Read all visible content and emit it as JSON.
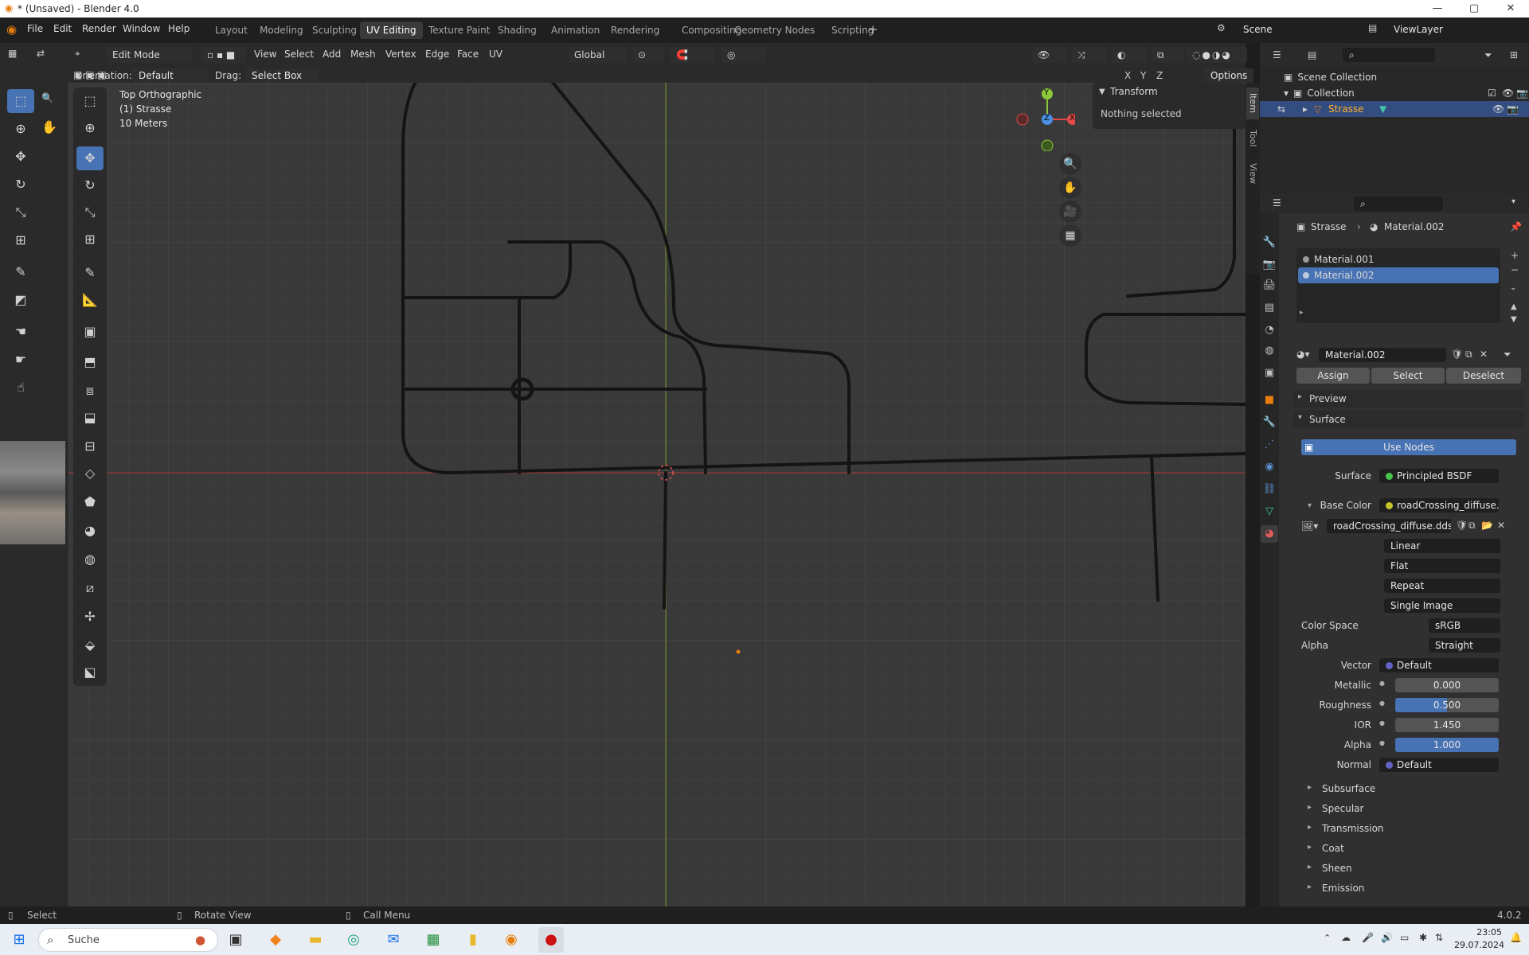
{
  "titlebar": {
    "title": "* (Unsaved) - Blender 4.0",
    "min": "—",
    "max": "▢",
    "close": "✕"
  },
  "menu": {
    "file": "File",
    "edit": "Edit",
    "render": "Render",
    "window": "Window",
    "help": "Help"
  },
  "workspaces": [
    "Layout",
    "Modeling",
    "Sculpting",
    "UV Editing",
    "Texture Paint",
    "Shading",
    "Animation",
    "Rendering",
    "Compositing",
    "Geometry Nodes",
    "Scripting"
  ],
  "active_workspace": "UV Editing",
  "scene": {
    "scene_name": "Scene",
    "view_layer": "ViewLayer"
  },
  "viewport_header": {
    "mode": "Edit Mode",
    "view": "View",
    "select": "Select",
    "add": "Add",
    "mesh": "Mesh",
    "vertex": "Vertex",
    "edge": "Edge",
    "face": "Face",
    "uv": "UV",
    "orientation_global": "Global",
    "orientation_label": "Orientation:",
    "orientation_value": "Default",
    "drag_label": "Drag:",
    "drag_value": "Select Box",
    "x": "X",
    "y": "Y",
    "z": "Z",
    "options": "Options"
  },
  "viewport_info": {
    "view_name": "Top Orthographic",
    "object": "(1) Strasse",
    "scale": "10 Meters"
  },
  "npanel": {
    "section": "Transform",
    "message": "Nothing selected",
    "tabs": [
      "Item",
      "Tool",
      "View"
    ]
  },
  "gizmo": {
    "x": "X",
    "y": "Y",
    "z": "Z"
  },
  "outliner": {
    "scene_collection": "Scene Collection",
    "collection": "Collection",
    "object": "Strasse"
  },
  "properties": {
    "breadcrumb_object": "Strasse",
    "breadcrumb_material": "Material.002",
    "slots": [
      "Material.001",
      "Material.002"
    ],
    "active_slot": "Material.002",
    "material_name": "Material.002",
    "assign": "Assign",
    "select": "Select",
    "deselect": "Deselect",
    "preview": "Preview",
    "surface_section": "Surface",
    "use_nodes": "Use Nodes",
    "surface_label": "Surface",
    "surface_value": "Principled BSDF",
    "base_color_label": "Base Color",
    "base_color_value": "roadCrossing_diffuse....",
    "image_name": "roadCrossing_diffuse.dds",
    "interp": "Linear",
    "projection": "Flat",
    "extension": "Repeat",
    "source": "Single Image",
    "color_space_label": "Color Space",
    "color_space": "sRGB",
    "alpha_mode_label": "Alpha",
    "alpha_mode": "Straight",
    "vector_label": "Vector",
    "vector": "Default",
    "metallic_label": "Metallic",
    "metallic": "0.000",
    "roughness_label": "Roughness",
    "roughness": "0.500",
    "ior_label": "IOR",
    "ior": "1.450",
    "alpha_label": "Alpha",
    "alpha": "1.000",
    "normal_label": "Normal",
    "normal": "Default",
    "subsections": [
      "Subsurface",
      "Specular",
      "Transmission",
      "Coat",
      "Sheen",
      "Emission"
    ]
  },
  "status": {
    "select": "Select",
    "rotate": "Rotate View",
    "call_menu": "Call Menu",
    "version": "4.0.2"
  },
  "taskbar": {
    "search": "Suche",
    "time": "23:05",
    "date": "29.07.2024"
  },
  "colors": {
    "accent": "#4772b3",
    "x_axis": "#e24a4a",
    "y_axis": "#8ac73a",
    "z_axis": "#4a8ee2",
    "orange": "#e87d0d"
  }
}
